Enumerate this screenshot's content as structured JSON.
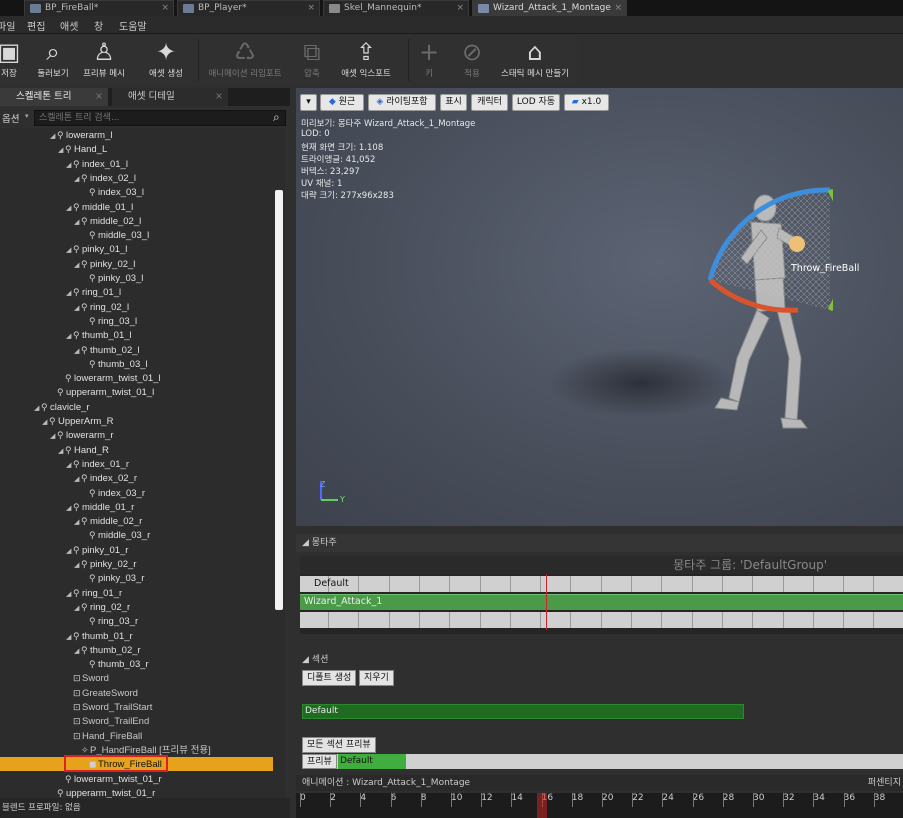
{
  "tabs": [
    {
      "label": "BP_FireBall*",
      "active": false
    },
    {
      "label": "BP_Player*",
      "active": false
    },
    {
      "label": "Skel_Mannequin*",
      "active": false
    },
    {
      "label": "Wizard_Attack_1_Montage",
      "active": true
    }
  ],
  "menu": [
    "파일",
    "편집",
    "애셋",
    "창",
    "도움말"
  ],
  "toolbar": [
    {
      "label": "저장",
      "icon": "save-icon",
      "enabled": true
    },
    {
      "label": "둘러보기",
      "icon": "browse-icon",
      "enabled": true
    },
    {
      "label": "프리뷰 메시",
      "icon": "preview-mesh-icon",
      "enabled": true
    },
    {
      "label": "애셋 생성",
      "icon": "create-asset-icon",
      "enabled": true
    },
    {
      "label": "애니메이션 리임포트",
      "icon": "reimport-icon",
      "enabled": false
    },
    {
      "label": "압축",
      "icon": "compress-icon",
      "enabled": false
    },
    {
      "label": "애셋 익스포트",
      "icon": "export-icon",
      "enabled": true
    },
    {
      "label": "키",
      "icon": "key-icon",
      "enabled": false
    },
    {
      "label": "적용",
      "icon": "apply-icon",
      "enabled": false
    },
    {
      "label": "스태틱 메시 만들기",
      "icon": "static-mesh-icon",
      "enabled": true
    }
  ],
  "left_panel": {
    "tabs": [
      {
        "label": "스켈레톤 트리"
      },
      {
        "label": "애셋 디테일"
      }
    ],
    "options_label": "옵션",
    "search_placeholder": "스켈레톤 트리 검색...",
    "bottom_label": "블렌드 프로파일: 없음"
  },
  "tree": [
    {
      "label": "lowerarm_l",
      "depth": 7,
      "type": "bone",
      "expanded": true
    },
    {
      "label": "Hand_L",
      "depth": 8,
      "type": "bone",
      "expanded": true
    },
    {
      "label": "index_01_l",
      "depth": 9,
      "type": "bone",
      "expanded": true
    },
    {
      "label": "index_02_l",
      "depth": 10,
      "type": "bone",
      "expanded": true
    },
    {
      "label": "index_03_l",
      "depth": 11,
      "type": "bone"
    },
    {
      "label": "middle_01_l",
      "depth": 9,
      "type": "bone",
      "expanded": true
    },
    {
      "label": "middle_02_l",
      "depth": 10,
      "type": "bone",
      "expanded": true
    },
    {
      "label": "middle_03_l",
      "depth": 11,
      "type": "bone"
    },
    {
      "label": "pinky_01_l",
      "depth": 9,
      "type": "bone",
      "expanded": true
    },
    {
      "label": "pinky_02_l",
      "depth": 10,
      "type": "bone",
      "expanded": true
    },
    {
      "label": "pinky_03_l",
      "depth": 11,
      "type": "bone"
    },
    {
      "label": "ring_01_l",
      "depth": 9,
      "type": "bone",
      "expanded": true
    },
    {
      "label": "ring_02_l",
      "depth": 10,
      "type": "bone",
      "expanded": true
    },
    {
      "label": "ring_03_l",
      "depth": 11,
      "type": "bone"
    },
    {
      "label": "thumb_01_l",
      "depth": 9,
      "type": "bone",
      "expanded": true
    },
    {
      "label": "thumb_02_l",
      "depth": 10,
      "type": "bone",
      "expanded": true
    },
    {
      "label": "thumb_03_l",
      "depth": 11,
      "type": "bone"
    },
    {
      "label": "lowerarm_twist_01_l",
      "depth": 8,
      "type": "bone"
    },
    {
      "label": "upperarm_twist_01_l",
      "depth": 7,
      "type": "bone"
    },
    {
      "label": "clavicle_r",
      "depth": 5,
      "type": "bone",
      "expanded": true
    },
    {
      "label": "UpperArm_R",
      "depth": 6,
      "type": "bone",
      "expanded": true
    },
    {
      "label": "lowerarm_r",
      "depth": 7,
      "type": "bone",
      "expanded": true
    },
    {
      "label": "Hand_R",
      "depth": 8,
      "type": "bone",
      "expanded": true
    },
    {
      "label": "index_01_r",
      "depth": 9,
      "type": "bone",
      "expanded": true
    },
    {
      "label": "index_02_r",
      "depth": 10,
      "type": "bone",
      "expanded": true
    },
    {
      "label": "index_03_r",
      "depth": 11,
      "type": "bone"
    },
    {
      "label": "middle_01_r",
      "depth": 9,
      "type": "bone",
      "expanded": true
    },
    {
      "label": "middle_02_r",
      "depth": 10,
      "type": "bone",
      "expanded": true
    },
    {
      "label": "middle_03_r",
      "depth": 11,
      "type": "bone"
    },
    {
      "label": "pinky_01_r",
      "depth": 9,
      "type": "bone",
      "expanded": true
    },
    {
      "label": "pinky_02_r",
      "depth": 10,
      "type": "bone",
      "expanded": true
    },
    {
      "label": "pinky_03_r",
      "depth": 11,
      "type": "bone"
    },
    {
      "label": "ring_01_r",
      "depth": 9,
      "type": "bone",
      "expanded": true
    },
    {
      "label": "ring_02_r",
      "depth": 10,
      "type": "bone",
      "expanded": true
    },
    {
      "label": "ring_03_r",
      "depth": 11,
      "type": "bone"
    },
    {
      "label": "thumb_01_r",
      "depth": 9,
      "type": "bone",
      "expanded": true
    },
    {
      "label": "thumb_02_r",
      "depth": 10,
      "type": "bone",
      "expanded": true
    },
    {
      "label": "thumb_03_r",
      "depth": 11,
      "type": "bone"
    },
    {
      "label": "Sword",
      "depth": 9,
      "type": "socket"
    },
    {
      "label": "GreateSword",
      "depth": 9,
      "type": "socket"
    },
    {
      "label": "Sword_TrailStart",
      "depth": 9,
      "type": "socket"
    },
    {
      "label": "Sword_TrailEnd",
      "depth": 9,
      "type": "socket"
    },
    {
      "label": "Hand_FireBall",
      "depth": 9,
      "type": "socket"
    },
    {
      "label": "P_HandFireBall [프리뷰 전용]",
      "depth": 10,
      "type": "preview"
    },
    {
      "label": "Throw_FireBall",
      "depth": 9,
      "type": "socket",
      "selected": true
    },
    {
      "label": "lowerarm_twist_01_r",
      "depth": 8,
      "type": "bone"
    },
    {
      "label": "upperarm_twist_01_r",
      "depth": 7,
      "type": "bone"
    }
  ],
  "viewport": {
    "buttons": [
      {
        "label": "",
        "icon": "dropdown-icon"
      },
      {
        "label": "원근",
        "icon": "perspective-icon"
      },
      {
        "label": "라이팅포함",
        "icon": "lit-icon"
      },
      {
        "label": "표시"
      },
      {
        "label": "캐릭터"
      },
      {
        "label": "LOD 자동"
      },
      {
        "label": "x1.0",
        "icon": "speed-icon"
      }
    ],
    "stats": [
      "미리보기: 몽타주 Wizard_Attack_1_Montage",
      "LOD: 0",
      "현재 화면 크기: 1.108",
      "트라이앵글: 41,052",
      "버텍스: 23,297",
      "UV 채널: 1",
      "대략 크기: 277x96x283"
    ],
    "socket_label": "Throw_FireBall",
    "axis_labels": {
      "z": "Z",
      "y": "Y"
    }
  },
  "montage": {
    "header": "몽타주",
    "group_title": "몽타주 그룹: 'DefaultGroup'",
    "slot_name": "Default",
    "segment": "Wizard_Attack_1"
  },
  "sections": {
    "header": "섹션",
    "create_default": "디폴트 생성",
    "clear": "지우기",
    "section_name": "Default",
    "preview_all": "모든 섹션 프리뷰",
    "preview_label": "프리뷰",
    "preview_section": "Default"
  },
  "timeline": {
    "label": "애니메이션 : Wizard_Attack_1_Montage",
    "right_label": "퍼센티지",
    "ticks": [
      "0",
      "2",
      "4",
      "6",
      "8",
      "10",
      "12",
      "14",
      "16",
      "18",
      "20",
      "22",
      "24",
      "26",
      "28",
      "30",
      "32",
      "34",
      "36",
      "38"
    ],
    "current_frame": 16
  },
  "colors": {
    "selection": "#e6a21b",
    "montage_green": "#4a9a4a",
    "section_green": "#1f6b22",
    "scrubber": "#d0222a",
    "gizmo_blue": "#3d8fdc",
    "gizmo_red": "#d9542c",
    "gizmo_green": "#7fc23a"
  }
}
